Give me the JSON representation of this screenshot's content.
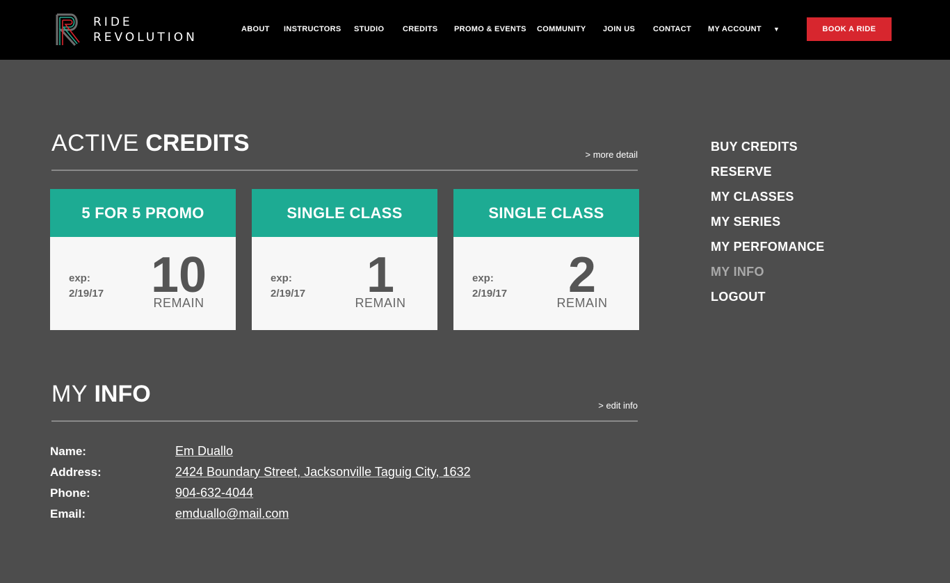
{
  "brand": {
    "name_line1": "RIDE",
    "name_line2": "REVOLUTION",
    "accent": "#d7262e",
    "teal": "#1dab93"
  },
  "nav": {
    "items": [
      "ABOUT",
      "INSTRUCTORS",
      "STUDIO",
      "CREDITS",
      "PROMO & EVENTS",
      "COMMUNITY",
      "JOIN US",
      "CONTACT",
      "MY ACCOUNT"
    ],
    "caret": "▼",
    "book_label": "BOOK A RIDE"
  },
  "credits": {
    "title_light": "ACTIVE",
    "title_bold": "CREDITS",
    "more_link": "> more detail",
    "cards": [
      {
        "name": "5 FOR 5 PROMO",
        "exp_label": "exp:",
        "exp_date": "2/19/17",
        "count": "10",
        "remain": "REMAIN"
      },
      {
        "name": "SINGLE CLASS",
        "exp_label": "exp:",
        "exp_date": "2/19/17",
        "count": "1",
        "remain": "REMAIN"
      },
      {
        "name": "SINGLE CLASS",
        "exp_label": "exp:",
        "exp_date": "2/19/17",
        "count": "2",
        "remain": "REMAIN"
      }
    ]
  },
  "side_menu": {
    "items": [
      "BUY CREDITS",
      "RESERVE",
      "MY CLASSES",
      "MY SERIES",
      "MY PERFOMANCE",
      "MY INFO",
      "LOGOUT"
    ],
    "active": "MY INFO"
  },
  "info": {
    "title_light": "MY",
    "title_bold": "INFO",
    "edit_link": "> edit info",
    "rows": [
      {
        "label": "Name:",
        "value": "Em Duallo"
      },
      {
        "label": "Address:",
        "value": "2424 Boundary Street, Jacksonville Taguig City, 1632"
      },
      {
        "label": "Phone:",
        "value": "904-632-4044"
      },
      {
        "label": "Email:",
        "value": "emduallo@mail.com"
      }
    ]
  }
}
